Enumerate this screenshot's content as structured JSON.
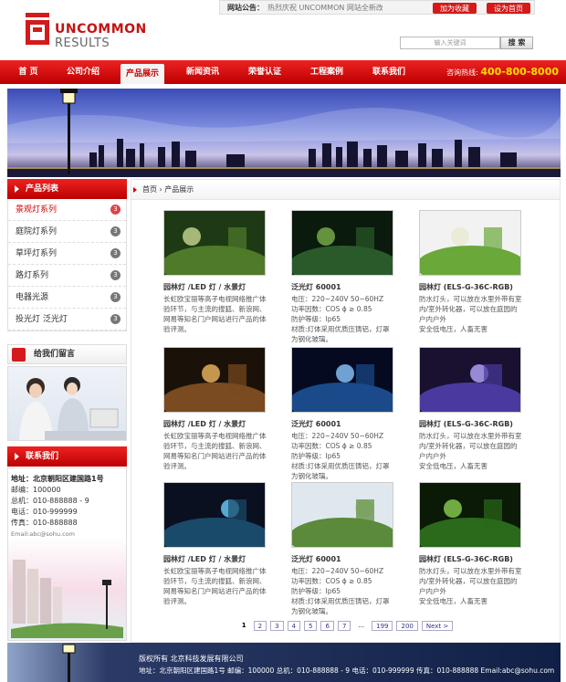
{
  "topbar": {
    "notice_label": "网站公告：",
    "notice_text": "热烈庆祝 UNCOMMON 网站全新改版",
    "bookmark_label": "加为收藏",
    "homepage_label": "设为首页"
  },
  "logo": {
    "line1": "UNCOMMON",
    "line2": "RESULTS"
  },
  "search": {
    "placeholder": "输入关键词",
    "button": "搜 索"
  },
  "nav": {
    "items": [
      "首 页",
      "公司介绍",
      "产品展示",
      "新闻资讯",
      "荣誉认证",
      "工程案例",
      "联系我们"
    ],
    "active": "产品展示",
    "hotline_label": "咨询热线:",
    "hotline_number": "400-800-8000"
  },
  "sidebar": {
    "title": "产品列表",
    "items": [
      {
        "label": "景观灯系列",
        "num": "3"
      },
      {
        "label": "庭院灯系列",
        "num": "3"
      },
      {
        "label": "草坪灯系列",
        "num": "3"
      },
      {
        "label": "路灯系列",
        "num": "3"
      },
      {
        "label": "电器光源",
        "num": "3"
      },
      {
        "label": "投光灯 泛光灯",
        "num": "3"
      }
    ],
    "message_title": "给我们留言",
    "contact_title": "联系我们",
    "contact_lines": [
      "地址：北京朝阳区建国路1号",
      "邮编：100000",
      "总机：010-888888 - 9",
      "电话：010-999999",
      "传真：010-888888",
      "Email:abc@sohu.com"
    ]
  },
  "breadcrumb": {
    "home": "首页",
    "sep": "›",
    "current": "产品展示"
  },
  "products": [
    {
      "title": "园林灯 /LED 灯 / 水景灯",
      "desc": "长虹欧宝丽等高子电视网络推广体验环节，与主流的搜狐、新浪网、网易等知名门户网站进行产品的体验评测。"
    },
    {
      "title": "泛光灯 60001",
      "desc": "电压：220~240V 50~60HZ\n功率因数：COS ϕ ≥ 0.85\n防护等级：Ip65\n材质:灯体采用优质压铸铝，灯罩为钢化玻璃。"
    },
    {
      "title": "园林灯 (ELS-G-36C-RGB)",
      "desc": "防水灯头，可以放在水里外带有室内/室外转化器，可以放在庭园的户内户外\n安全低电压，人畜无害"
    },
    {
      "title": "园林灯 /LED 灯 / 水景灯",
      "desc": "长虹欧宝丽等高子电视网络推广体验环节，与主流的搜狐、新浪网、网易等知名门户网站进行产品的体验评测。"
    },
    {
      "title": "泛光灯 60001",
      "desc": "电压：220~240V 50~60HZ\n功率因数：COS ϕ ≥ 0.85\n防护等级：Ip65\n材质:灯体采用优质压铸铝，灯罩为钢化玻璃。"
    },
    {
      "title": "园林灯 (ELS-G-36C-RGB)",
      "desc": "防水灯头，可以放在水里外带有室内/室外转化器，可以放在庭园的户内户外\n安全低电压，人畜无害"
    },
    {
      "title": "园林灯 /LED 灯 / 水景灯",
      "desc": "长虹欧宝丽等高子电视网络推广体验环节，与主流的搜狐、新浪网、网易等知名门户网站进行产品的体验评测。"
    },
    {
      "title": "泛光灯 60001",
      "desc": "电压：220~240V 50~60HZ\n功率因数：COS ϕ ≥ 0.85\n防护等级：Ip65\n材质:灯体采用优质压铸铝，灯罩为钢化玻璃。"
    },
    {
      "title": "园林灯 (ELS-G-36C-RGB)",
      "desc": "防水灯头，可以放在水里外带有室内/室外转化器，可以放在庭园的户内户外\n安全低电压，人畜无害"
    }
  ],
  "pagination": [
    "1",
    "2",
    "3",
    "4",
    "5",
    "6",
    "7",
    "...",
    "199",
    "200",
    "Next >"
  ],
  "footer": {
    "copyright": "版权所有  北京科技发展有限公司",
    "info": "地址：北京朝阳区建国路1号 邮编：100000  总机：010-888888 - 9 电话：010-999999 传真：010-888888 Email:abc@sohu.com"
  },
  "colors": {
    "brand_red": "#d41a1a",
    "hotline_yellow": "#ffde00",
    "footer_navy": "#0f1f45"
  }
}
